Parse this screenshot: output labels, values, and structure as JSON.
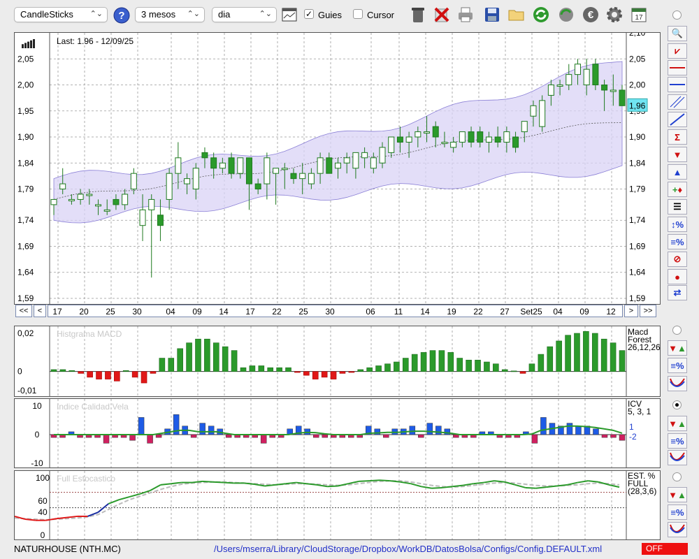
{
  "toolbar": {
    "symbol_select": "CandleSticks",
    "period_select": "3 mesos",
    "interval_select": "dia",
    "guides_label": "Guies",
    "guides_checked": true,
    "cursor_label": "Cursor",
    "cursor_checked": false,
    "icons": [
      "help-icon",
      "chart-window-icon",
      "trash-icon",
      "delete-icon",
      "print-icon",
      "save-icon",
      "open-folder-icon",
      "refresh-icon",
      "globe-refresh-icon",
      "euro-icon",
      "settings-gear-icon",
      "calendar-icon"
    ]
  },
  "main_chart": {
    "last_label": "Last: 1.96 - 12/09/25",
    "last_value": "1,96",
    "top_cut_label": "2,10",
    "y_ticks": [
      "2,05",
      "2,00",
      "1,95",
      "1,90",
      "1,84",
      "1,79",
      "1,74",
      "1,69",
      "1,64",
      "1,59"
    ],
    "date_labels": [
      "17",
      "20",
      "25",
      "30",
      "04",
      "09",
      "14",
      "17",
      "22",
      "25",
      "30",
      "06",
      "11",
      "14",
      "19",
      "22",
      "27",
      "Set25",
      "04",
      "09",
      "12"
    ],
    "nav": {
      "first": "<<",
      "prev": "<",
      "next": ">",
      "last": ">>"
    }
  },
  "macd": {
    "title": "Histgrama MACD",
    "y_ticks": [
      "0,02",
      "0",
      "-0,01"
    ],
    "legend": [
      "Macd",
      "Forest",
      "26,12,26"
    ]
  },
  "icv": {
    "title": "Indice Calidad Vela",
    "y_ticks": [
      "10",
      "0",
      "-10"
    ],
    "legend": [
      "ICV",
      "5, 3, 1"
    ],
    "value_pos": "1",
    "value_neg": "-2"
  },
  "stoch": {
    "title": "Full Estocastico",
    "y_ticks": [
      "100",
      "60",
      "40",
      "0"
    ],
    "legend": [
      "EST. %",
      "FULL",
      "(28,3,6)"
    ]
  },
  "status": {
    "ticker": "NATURHOUSE (NTH.MC)",
    "path": "/Users/mserra/Library/CloudStorage/Dropbox/WorkDB/DatosBolsa/Configs/Config.DEFAULT.xml",
    "badge": "OFF"
  },
  "chart_data": [
    {
      "type": "candlestick",
      "ylim": [
        1.59,
        2.1
      ],
      "series": [
        {
          "name": "ohlc",
          "values": [
            [
              1.77,
              1.78,
              1.75,
              1.78
            ],
            [
              1.8,
              1.84,
              1.79,
              1.81
            ],
            [
              1.78,
              1.79,
              1.77,
              1.78
            ],
            [
              1.78,
              1.8,
              1.77,
              1.79
            ],
            [
              1.79,
              1.8,
              1.77,
              1.79
            ],
            [
              1.77,
              1.78,
              1.75,
              1.77
            ],
            [
              1.76,
              1.78,
              1.75,
              1.76
            ],
            [
              1.78,
              1.79,
              1.76,
              1.77
            ],
            [
              1.77,
              1.8,
              1.76,
              1.79
            ],
            [
              1.8,
              1.84,
              1.79,
              1.83
            ],
            [
              1.73,
              1.79,
              1.7,
              1.76
            ],
            [
              1.76,
              1.79,
              1.63,
              1.78
            ],
            [
              1.75,
              1.78,
              1.7,
              1.73
            ],
            [
              1.78,
              1.84,
              1.76,
              1.83
            ],
            [
              1.83,
              1.89,
              1.8,
              1.86
            ],
            [
              1.81,
              1.83,
              1.79,
              1.82
            ],
            [
              1.8,
              1.85,
              1.78,
              1.84
            ],
            [
              1.87,
              1.88,
              1.84,
              1.86
            ],
            [
              1.86,
              1.87,
              1.82,
              1.84
            ],
            [
              1.84,
              1.86,
              1.83,
              1.85
            ],
            [
              1.86,
              1.87,
              1.82,
              1.83
            ],
            [
              1.83,
              1.86,
              1.82,
              1.86
            ],
            [
              1.86,
              1.86,
              1.76,
              1.81
            ],
            [
              1.81,
              1.82,
              1.79,
              1.8
            ],
            [
              1.81,
              1.87,
              1.78,
              1.86
            ],
            [
              1.83,
              1.84,
              1.77,
              1.84
            ],
            [
              1.84,
              1.85,
              1.8,
              1.84
            ],
            [
              1.83,
              1.84,
              1.81,
              1.82
            ],
            [
              1.82,
              1.85,
              1.79,
              1.83
            ],
            [
              1.81,
              1.84,
              1.8,
              1.83
            ],
            [
              1.83,
              1.87,
              1.81,
              1.86
            ],
            [
              1.86,
              1.87,
              1.83,
              1.83
            ],
            [
              1.84,
              1.86,
              1.82,
              1.85
            ],
            [
              1.85,
              1.87,
              1.83,
              1.86
            ],
            [
              1.84,
              1.87,
              1.82,
              1.87
            ],
            [
              1.86,
              1.88,
              1.84,
              1.87
            ],
            [
              1.84,
              1.87,
              1.83,
              1.86
            ],
            [
              1.85,
              1.89,
              1.84,
              1.88
            ],
            [
              1.87,
              1.9,
              1.86,
              1.9
            ],
            [
              1.9,
              1.92,
              1.87,
              1.89
            ],
            [
              1.89,
              1.91,
              1.86,
              1.9
            ],
            [
              1.9,
              1.92,
              1.88,
              1.91
            ],
            [
              1.91,
              1.94,
              1.89,
              1.91
            ],
            [
              1.92,
              1.93,
              1.88,
              1.9
            ],
            [
              1.89,
              1.91,
              1.88,
              1.89
            ],
            [
              1.88,
              1.9,
              1.87,
              1.89
            ],
            [
              1.89,
              1.91,
              1.88,
              1.91
            ],
            [
              1.91,
              1.92,
              1.88,
              1.89
            ],
            [
              1.91,
              1.92,
              1.88,
              1.89
            ],
            [
              1.89,
              1.91,
              1.87,
              1.9
            ],
            [
              1.9,
              1.92,
              1.88,
              1.89
            ],
            [
              1.89,
              1.92,
              1.87,
              1.91
            ],
            [
              1.9,
              1.91,
              1.87,
              1.88
            ],
            [
              1.91,
              1.93,
              1.89,
              1.93
            ],
            [
              1.94,
              1.97,
              1.92,
              1.96
            ],
            [
              1.92,
              1.98,
              1.91,
              1.97
            ],
            [
              1.98,
              2.01,
              1.96,
              2.0
            ],
            [
              2.0,
              2.01,
              1.98,
              2.0
            ],
            [
              2.0,
              2.04,
              1.99,
              2.02
            ],
            [
              2.02,
              2.05,
              2.0,
              2.04
            ],
            [
              2.0,
              2.05,
              1.98,
              2.03
            ],
            [
              2.04,
              2.05,
              1.99,
              2.0
            ],
            [
              2.0,
              2.01,
              1.95,
              1.99
            ],
            [
              1.99,
              2.02,
              1.96,
              1.99
            ],
            [
              1.99,
              2.0,
              1.96,
              1.96
            ]
          ]
        }
      ],
      "x_tick_labels": [
        "17",
        "20",
        "25",
        "30",
        "04",
        "09",
        "14",
        "17",
        "22",
        "25",
        "30",
        "06",
        "11",
        "14",
        "19",
        "22",
        "27",
        "Set25",
        "04",
        "09",
        "12"
      ],
      "bollinger": {
        "upper_start": 1.8,
        "upper_end": 2.03,
        "lower_start": 1.74,
        "lower_end": 1.84,
        "mid_start": 1.78,
        "mid_end": 1.93
      },
      "last": 1.96
    },
    {
      "type": "bar",
      "name": "MACD histogram",
      "ylim": [
        -0.01,
        0.02
      ],
      "values": [
        0.001,
        0.001,
        0.0005,
        -0.001,
        -0.003,
        -0.004,
        -0.004,
        -0.005,
        0.0005,
        -0.003,
        -0.006,
        -0.001,
        0.007,
        0.007,
        0.012,
        0.015,
        0.017,
        0.017,
        0.015,
        0.013,
        0.011,
        0.002,
        0.003,
        0.003,
        0.002,
        0.002,
        0.002,
        -0.0005,
        -0.002,
        -0.004,
        -0.003,
        -0.004,
        -0.001,
        -0.0005,
        0.001,
        0.002,
        0.003,
        0.004,
        0.005,
        0.007,
        0.009,
        0.01,
        0.011,
        0.011,
        0.01,
        0.007,
        0.006,
        0.006,
        0.005,
        0.004,
        0.001,
        0.0003,
        -0.001,
        0.004,
        0.009,
        0.013,
        0.016,
        0.019,
        0.02,
        0.021,
        0.02,
        0.017,
        0.015,
        0.011
      ]
    },
    {
      "type": "bar",
      "name": "ICV",
      "ylim": [
        -10,
        10
      ],
      "values": [
        -1,
        -1,
        1,
        -1,
        -1,
        -1,
        -3,
        -1,
        -1,
        -2,
        6,
        -3,
        -1,
        2,
        7,
        3,
        -1,
        4,
        3,
        2,
        -1,
        -1,
        -1,
        -1,
        -3,
        -1,
        -1,
        2,
        3,
        2,
        -1,
        -1,
        -1,
        -1,
        -1,
        -1,
        3,
        2,
        -1,
        2,
        2,
        3,
        -1,
        4,
        3,
        2,
        -1,
        -1,
        -1,
        1,
        1,
        -1,
        -1,
        -1,
        1,
        -3,
        6,
        4,
        3,
        4,
        3,
        3,
        2,
        -1,
        -1,
        -2
      ],
      "line": [
        0,
        0,
        0,
        0,
        0,
        0,
        0,
        0,
        0,
        0,
        0,
        0,
        0.5,
        1,
        1.5,
        1.5,
        1,
        1,
        1,
        0.5,
        0,
        0,
        0,
        0,
        0,
        0,
        0,
        0.5,
        0.8,
        0.7,
        0.3,
        0,
        0,
        0,
        0,
        0.5,
        0.6,
        0.8,
        0.8,
        1,
        1.2,
        1.2,
        1,
        0.8,
        0.5,
        0,
        0,
        0,
        0,
        0,
        0,
        0,
        0,
        0.2,
        1.5,
        2,
        2.5,
        3,
        3,
        2.8,
        2.5,
        2,
        1.5,
        0.5
      ]
    },
    {
      "type": "line",
      "name": "Full Stochastic",
      "ylim": [
        0,
        100
      ],
      "series": [
        {
          "name": "%K",
          "values": [
            33,
            28,
            26,
            26,
            29,
            31,
            33,
            33,
            40,
            55,
            62,
            67,
            72,
            78,
            88,
            90,
            92,
            92,
            94,
            93,
            92,
            91,
            91,
            89,
            86,
            88,
            90,
            92,
            90,
            88,
            85,
            86,
            90,
            94,
            95,
            96,
            95,
            93,
            90,
            85,
            82,
            83,
            85,
            87,
            90,
            92,
            95,
            93,
            88,
            83,
            82,
            84,
            86,
            88,
            92,
            95,
            93,
            88,
            84
          ]
        },
        {
          "name": "%D",
          "values": [
            30,
            29,
            28,
            27,
            28,
            29,
            30,
            32,
            36,
            45,
            54,
            62,
            68,
            74,
            80,
            85,
            89,
            91,
            92,
            93,
            93,
            92,
            91,
            90,
            89,
            88,
            89,
            90,
            90,
            89,
            88,
            87,
            88,
            90,
            92,
            94,
            95,
            95,
            93,
            90,
            87,
            85,
            84,
            85,
            87,
            89,
            91,
            92,
            91,
            89,
            87,
            86,
            86,
            87,
            88,
            90,
            91,
            90,
            88
          ]
        }
      ]
    }
  ]
}
